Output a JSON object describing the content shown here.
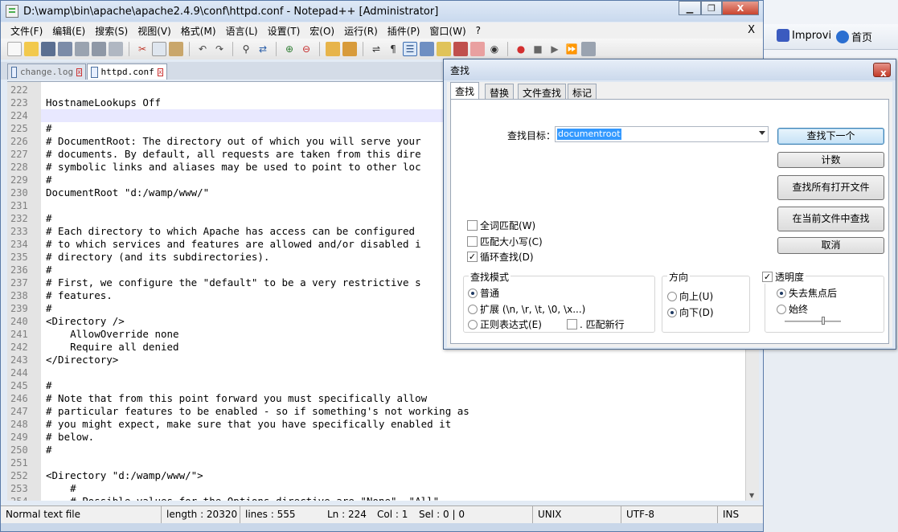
{
  "window": {
    "title": "D:\\wamp\\bin\\apache\\apache2.4.9\\conf\\httpd.conf - Notepad++ [Administrator]",
    "min_label": "▭",
    "max_label": "□",
    "close_label": "X"
  },
  "menu": [
    "文件(F)",
    "编辑(E)",
    "搜索(S)",
    "视图(V)",
    "格式(M)",
    "语言(L)",
    "设置(T)",
    "宏(O)",
    "运行(R)",
    "插件(P)",
    "窗口(W)",
    "?"
  ],
  "menu_close": "X",
  "tabs": [
    {
      "label": "change.log"
    },
    {
      "label": "httpd.conf"
    }
  ],
  "editor": {
    "lines": [
      {
        "n": "222",
        "t": ""
      },
      {
        "n": "223",
        "t": "HostnameLookups Off"
      },
      {
        "n": "224",
        "t": ""
      },
      {
        "n": "225",
        "t": "#"
      },
      {
        "n": "226",
        "t": "# DocumentRoot: The directory out of which you will serve your"
      },
      {
        "n": "227",
        "t": "# documents. By default, all requests are taken from this dire"
      },
      {
        "n": "228",
        "t": "# symbolic links and aliases may be used to point to other loc"
      },
      {
        "n": "229",
        "t": "#"
      },
      {
        "n": "230",
        "t": "DocumentRoot \"d:/wamp/www/\""
      },
      {
        "n": "231",
        "t": ""
      },
      {
        "n": "232",
        "t": "#"
      },
      {
        "n": "233",
        "t": "# Each directory to which Apache has access can be configured"
      },
      {
        "n": "234",
        "t": "# to which services and features are allowed and/or disabled i"
      },
      {
        "n": "235",
        "t": "# directory (and its subdirectories)."
      },
      {
        "n": "236",
        "t": "#"
      },
      {
        "n": "237",
        "t": "# First, we configure the \"default\" to be a very restrictive s"
      },
      {
        "n": "238",
        "t": "# features."
      },
      {
        "n": "239",
        "t": "#"
      },
      {
        "n": "240",
        "t": "<Directory />"
      },
      {
        "n": "241",
        "t": "    AllowOverride none"
      },
      {
        "n": "242",
        "t": "    Require all denied"
      },
      {
        "n": "243",
        "t": "</Directory>"
      },
      {
        "n": "244",
        "t": ""
      },
      {
        "n": "245",
        "t": "#"
      },
      {
        "n": "246",
        "t": "# Note that from this point forward you must specifically allow"
      },
      {
        "n": "247",
        "t": "# particular features to be enabled - so if something's not working as"
      },
      {
        "n": "248",
        "t": "# you might expect, make sure that you have specifically enabled it"
      },
      {
        "n": "249",
        "t": "# below."
      },
      {
        "n": "250",
        "t": "#"
      },
      {
        "n": "251",
        "t": ""
      },
      {
        "n": "252",
        "t": "<Directory \"d:/wamp/www/\">"
      },
      {
        "n": "253",
        "t": "    #"
      },
      {
        "n": "254",
        "t": "    # Possible values for the Options directive are \"None\", \"All\""
      }
    ]
  },
  "status": {
    "type": "Normal text file",
    "length": "length : 20320",
    "lines": "lines : 555",
    "ln": "Ln : 224",
    "col": "Col : 1",
    "sel": "Sel : 0 | 0",
    "eol": "UNIX",
    "encoding": "UTF-8",
    "mode": "INS"
  },
  "browser": {
    "fav1": "Improvi",
    "fav2": "首页"
  },
  "find_dialog": {
    "title": "查找",
    "close_label": "x",
    "tabs": [
      "查找",
      "替换",
      "文件查找",
      "标记"
    ],
    "target_label": "查找目标：",
    "target_value": "documentroot",
    "buttons": {
      "find_next": "查找下一个",
      "count": "计数",
      "find_all_open": "查找所有打开文件",
      "find_current": "在当前文件中查找",
      "cancel": "取消"
    },
    "checks": {
      "whole_word": "全词匹配(W)",
      "match_case": "匹配大小写(C)",
      "wrap": "循环查找(D)"
    },
    "search_mode": {
      "title": "查找模式",
      "normal": "普通",
      "extended": "扩展 (\\n, \\r, \\t, \\0, \\x...)",
      "regex": "正则表达式(E)",
      "dot_newline": ". 匹配新行"
    },
    "direction": {
      "title": "方向",
      "up": "向上(U)",
      "down": "向下(D)"
    },
    "transparency": {
      "title": "透明度",
      "on_lose_focus": "失去焦点后",
      "always": "始终"
    }
  },
  "colors": {
    "accent": "#3399ff",
    "current_line": "#e8e8ff"
  }
}
